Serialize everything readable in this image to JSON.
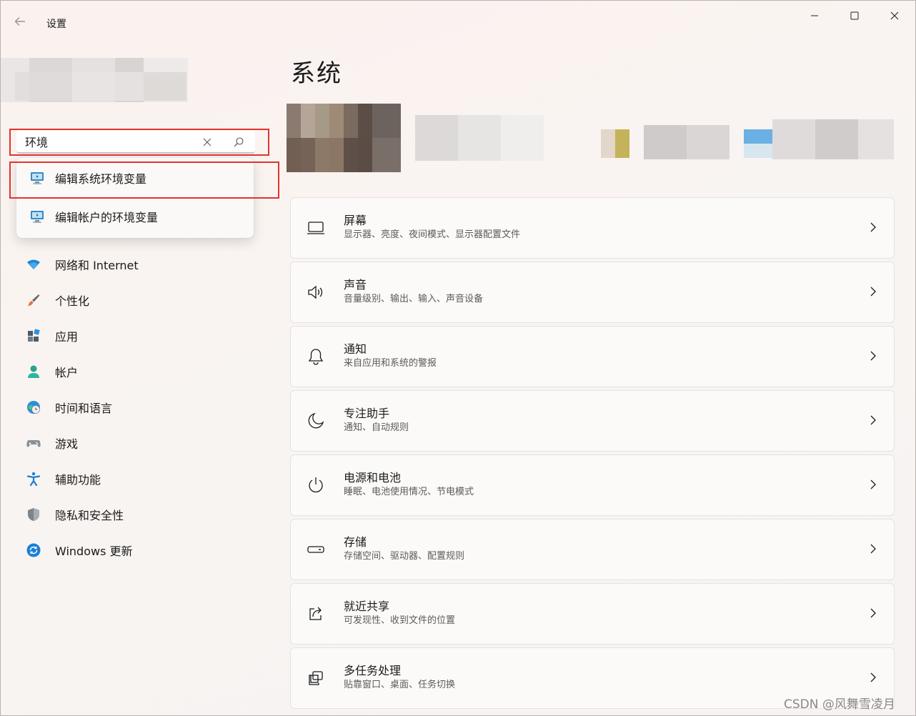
{
  "titlebar": {
    "app_title": "设置",
    "back_icon": "arrow-left-icon",
    "minimize_icon": "minimize-icon",
    "maximize_icon": "maximize-icon",
    "close_icon": "close-icon"
  },
  "search": {
    "value": "环境",
    "clear_icon": "close-icon",
    "search_icon": "search-icon",
    "results": [
      {
        "label": "编辑系统环境变量",
        "icon": "system-properties-icon"
      },
      {
        "label": "编辑帐户的环境变量",
        "icon": "system-properties-icon"
      }
    ]
  },
  "sidebar": {
    "items": [
      {
        "label": "网络和 Internet",
        "icon": "wifi-icon"
      },
      {
        "label": "个性化",
        "icon": "brush-icon"
      },
      {
        "label": "应用",
        "icon": "apps-icon"
      },
      {
        "label": "帐户",
        "icon": "person-icon"
      },
      {
        "label": "时间和语言",
        "icon": "globe-clock-icon"
      },
      {
        "label": "游戏",
        "icon": "gamepad-icon"
      },
      {
        "label": "辅助功能",
        "icon": "accessibility-icon"
      },
      {
        "label": "隐私和安全性",
        "icon": "shield-icon"
      },
      {
        "label": "Windows 更新",
        "icon": "update-icon"
      }
    ]
  },
  "main": {
    "title": "系统",
    "cards": [
      {
        "title": "屏幕",
        "subtitle": "显示器、亮度、夜间模式、显示器配置文件",
        "icon": "monitor-icon"
      },
      {
        "title": "声音",
        "subtitle": "音量级别、输出、输入、声音设备",
        "icon": "speaker-icon"
      },
      {
        "title": "通知",
        "subtitle": "来自应用和系统的警报",
        "icon": "bell-icon"
      },
      {
        "title": "专注助手",
        "subtitle": "通知、自动规则",
        "icon": "moon-icon"
      },
      {
        "title": "电源和电池",
        "subtitle": "睡眠、电池使用情况、节电模式",
        "icon": "power-icon"
      },
      {
        "title": "存储",
        "subtitle": "存储空间、驱动器、配置规则",
        "icon": "storage-icon"
      },
      {
        "title": "就近共享",
        "subtitle": "可发现性、收到文件的位置",
        "icon": "share-icon"
      },
      {
        "title": "多任务处理",
        "subtitle": "贴靠窗口、桌面、任务切换",
        "icon": "multitask-icon"
      }
    ]
  },
  "watermark": "CSDN @风舞雪凌月",
  "colors": {
    "highlight_red": "#e0342f",
    "accent_blue": "#0067c0"
  }
}
